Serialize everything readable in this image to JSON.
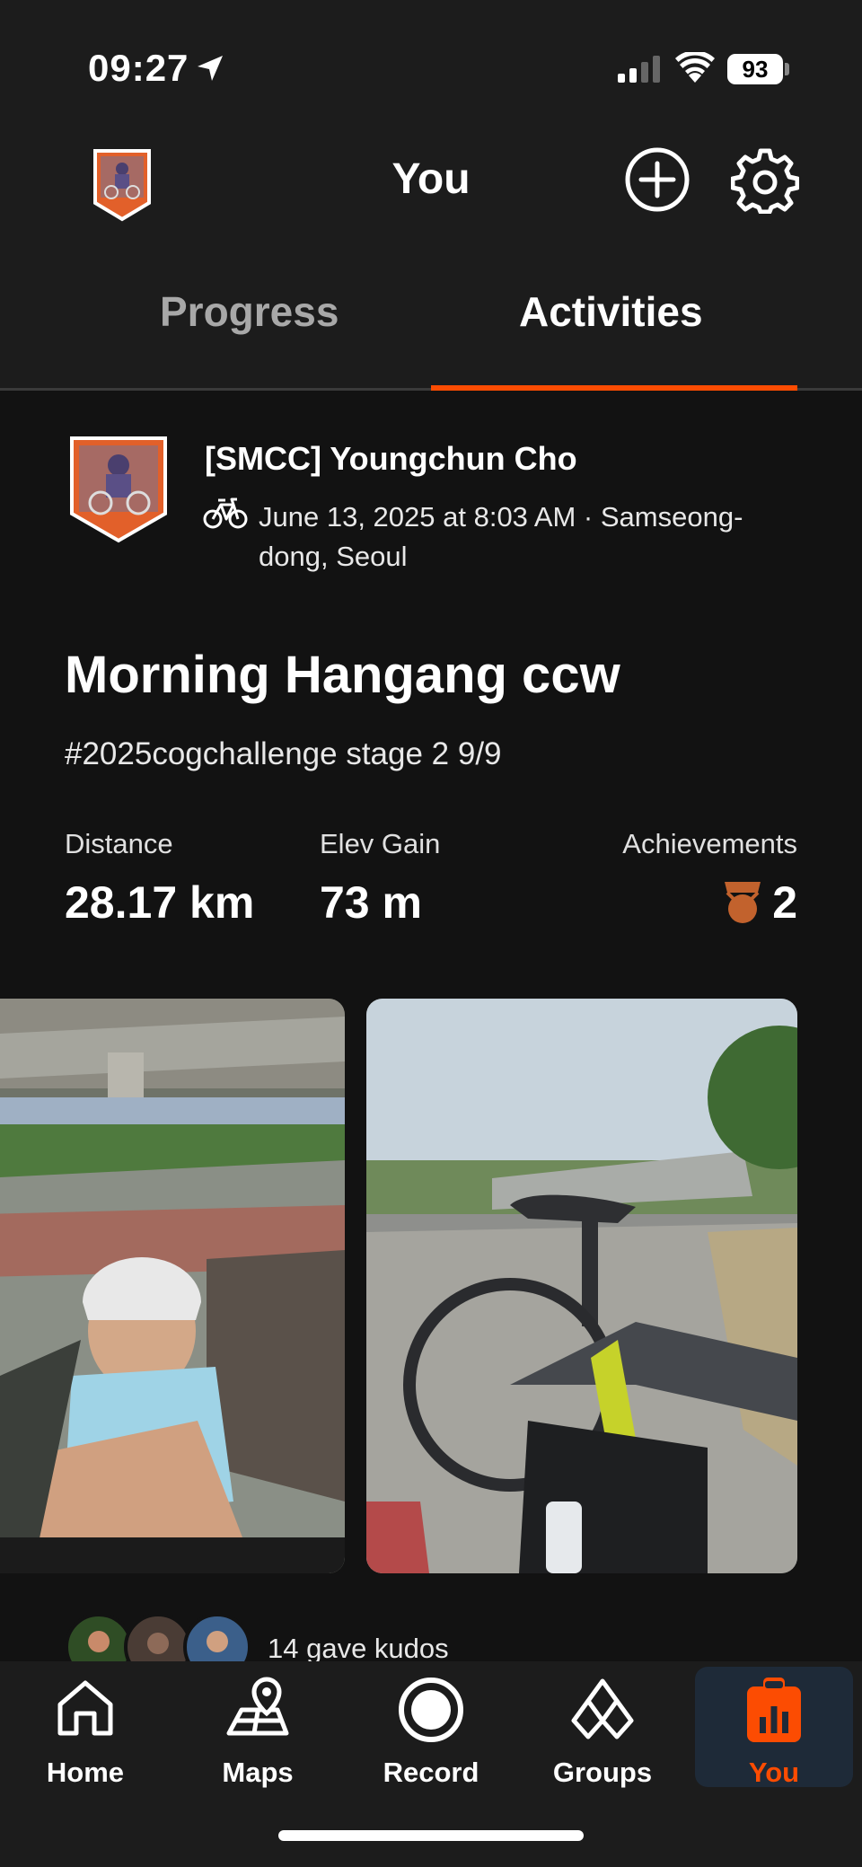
{
  "status_bar": {
    "time": "09:27",
    "battery": "93"
  },
  "header": {
    "title": "You"
  },
  "tabs": [
    {
      "label": "Progress",
      "active": false
    },
    {
      "label": "Activities",
      "active": true
    }
  ],
  "activity": {
    "athlete_name": "[SMCC] Youngchun Cho",
    "date_location": "June 13, 2025 at 8:03 AM · Samseong-dong, Seoul",
    "title": "Morning Hangang ccw",
    "description": "#2025cogchallenge stage 2 9/9",
    "stats": {
      "distance_label": "Distance",
      "distance_value": "28.17 km",
      "elev_label": "Elev Gain",
      "elev_value": "73 m",
      "achievements_label": "Achievements",
      "achievements_value": "2"
    },
    "kudos_text": "14 gave kudos"
  },
  "bottom_nav": [
    {
      "label": "Home",
      "icon": "home-icon"
    },
    {
      "label": "Maps",
      "icon": "maps-icon"
    },
    {
      "label": "Record",
      "icon": "record-icon"
    },
    {
      "label": "Groups",
      "icon": "groups-icon"
    },
    {
      "label": "You",
      "icon": "you-icon",
      "active": true
    }
  ],
  "colors": {
    "accent": "#fc4c02",
    "background": "#121212",
    "surface": "#1c1c1c",
    "medal": "#c2622d"
  }
}
